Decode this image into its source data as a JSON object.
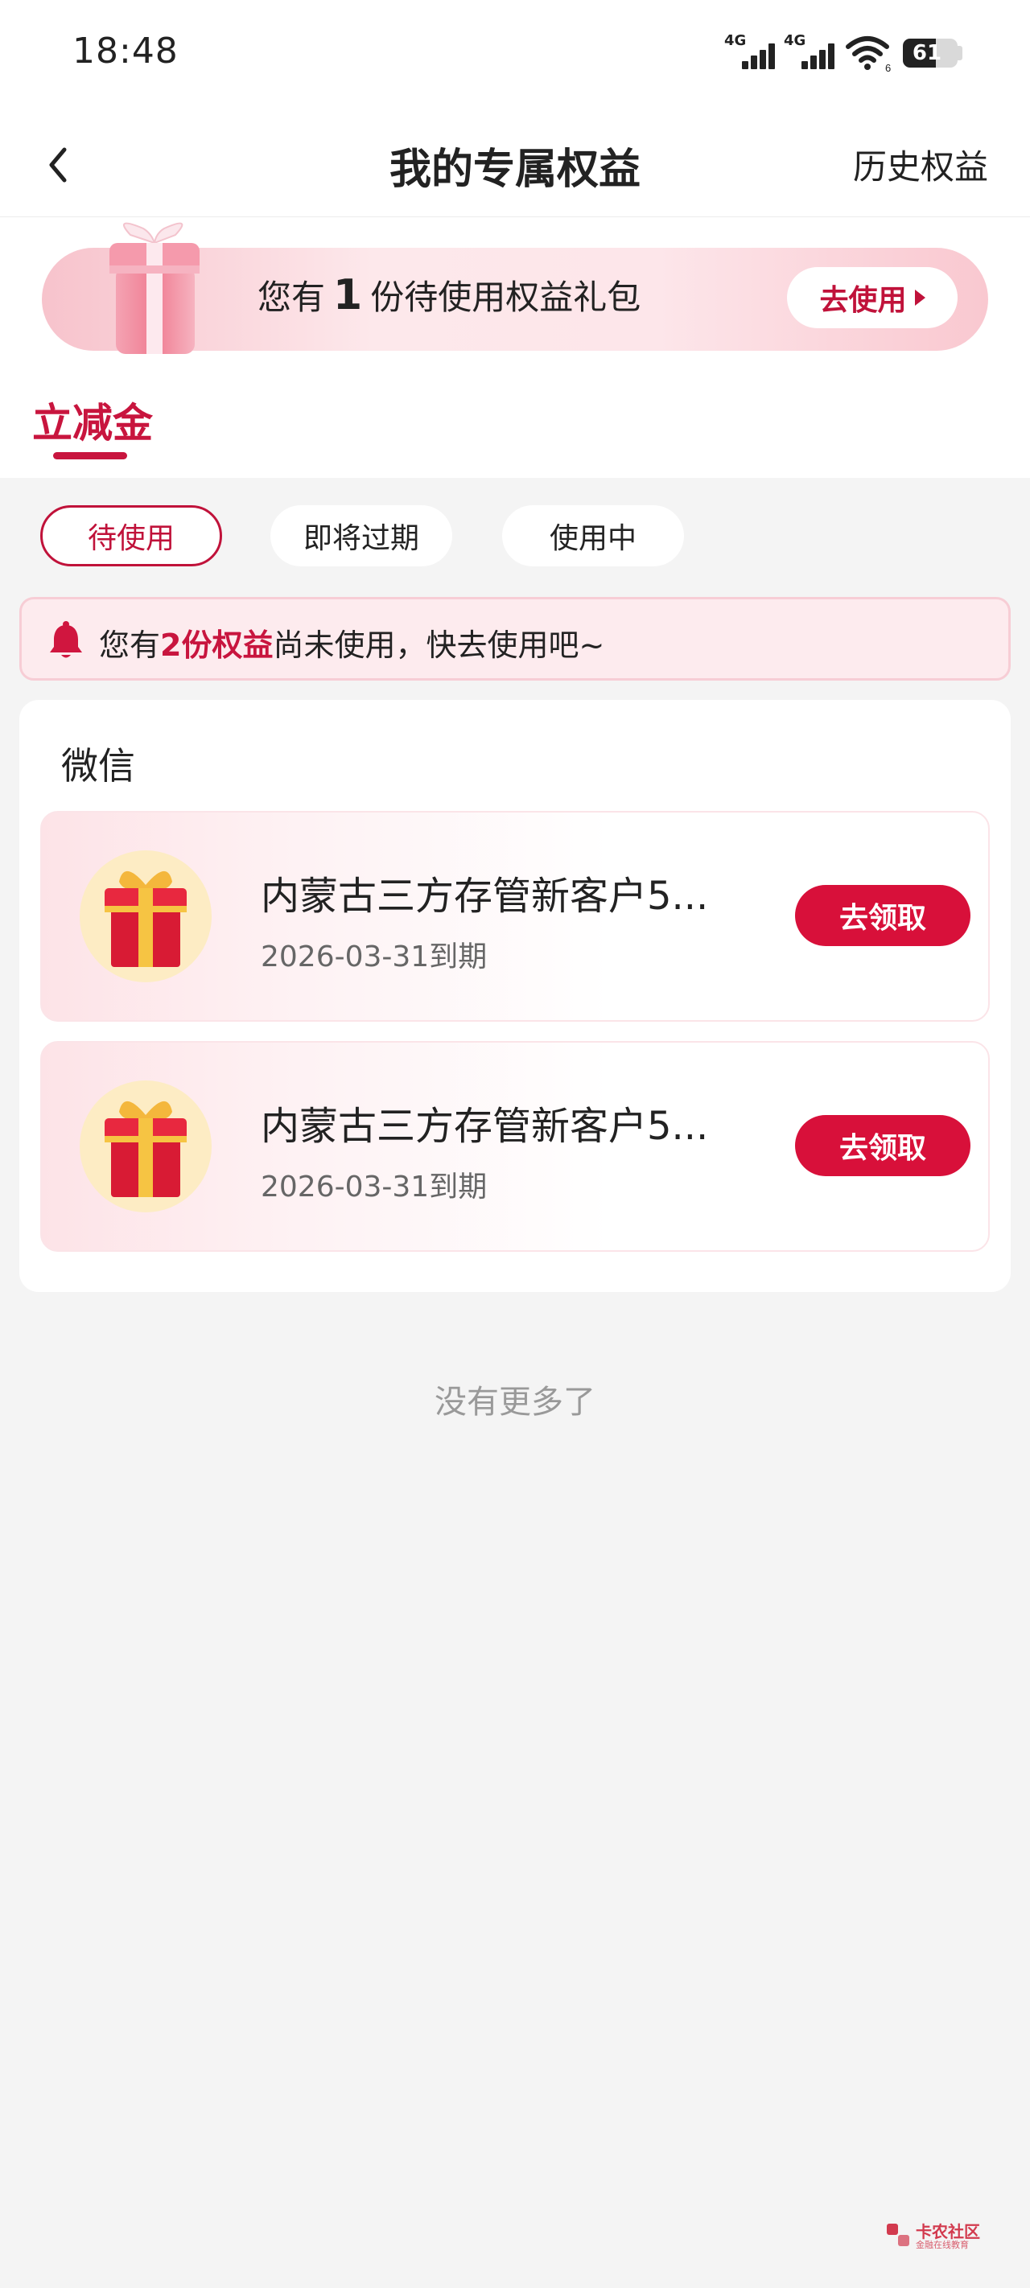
{
  "status_bar": {
    "time": "18:48",
    "signal_1_label": "4G",
    "signal_2_label": "4G",
    "wifi_badge": "6",
    "battery_level": "61",
    "battery_fraction": 0.61
  },
  "nav": {
    "title": "我的专属权益",
    "history_link": "历史权益",
    "back_icon": "chevron-left-icon"
  },
  "banner": {
    "prefix": "您有",
    "count": "1",
    "suffix": "份待使用权益礼包",
    "button_label": "去使用",
    "icon": "gift-box-icon"
  },
  "category_tab": {
    "label": "立减金"
  },
  "filters": [
    {
      "label": "待使用",
      "active": true
    },
    {
      "label": "即将过期",
      "active": false
    },
    {
      "label": "使用中",
      "active": false
    }
  ],
  "notice": {
    "prefix": "您有",
    "highlight": "2份权益",
    "suffix": "尚未使用，快去使用吧~",
    "icon": "bell-icon"
  },
  "wechat_card": {
    "title": "微信",
    "items": [
      {
        "name": "内蒙古三方存管新客户5...",
        "expiry": "2026-03-31到期",
        "button_label": "去领取",
        "icon": "gift-icon"
      },
      {
        "name": "内蒙古三方存管新客户5...",
        "expiry": "2026-03-31到期",
        "button_label": "去领取",
        "icon": "gift-icon"
      }
    ]
  },
  "footer": {
    "no_more": "没有更多了"
  },
  "watermark": {
    "title": "卡农社区",
    "subtitle": "金融在线教育"
  },
  "colors": {
    "accent": "#c8153e",
    "button_red": "#d8103a",
    "page_bg": "#f4f4f4"
  }
}
